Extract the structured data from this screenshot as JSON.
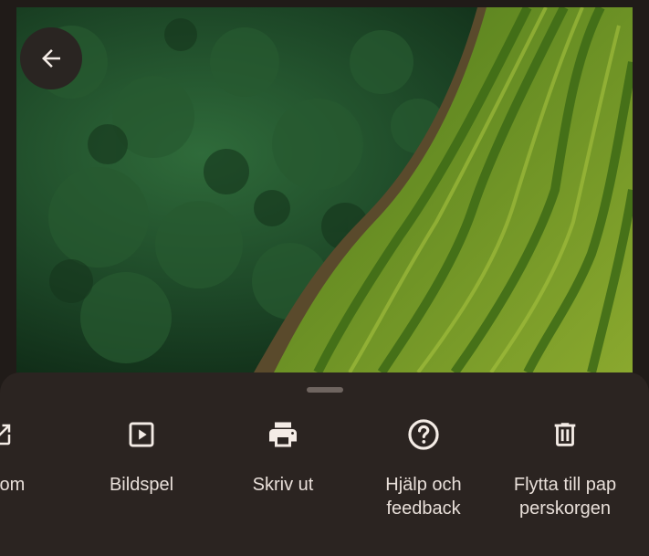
{
  "app": {
    "back_button_label": "Tillbaka"
  },
  "colors": {
    "background": "#201b18",
    "sheet": "#2b2421",
    "text": "#e8dfd9",
    "icon": "#f4ece6",
    "back_button": "#2a2522"
  },
  "photo": {
    "description_icon": "forest-and-rice-terraces-photo"
  },
  "sheet": {
    "actions": [
      {
        "label": "d som",
        "icon": "open-in-new-icon"
      },
      {
        "label": "Bildspel",
        "icon": "slideshow-icon"
      },
      {
        "label": "Skriv ut",
        "icon": "printer-icon"
      },
      {
        "label": "Hjälp och\nfeedback",
        "icon": "help-circle-icon"
      },
      {
        "label": "Flytta till pap\nperskorgen",
        "icon": "trash-icon"
      }
    ]
  }
}
